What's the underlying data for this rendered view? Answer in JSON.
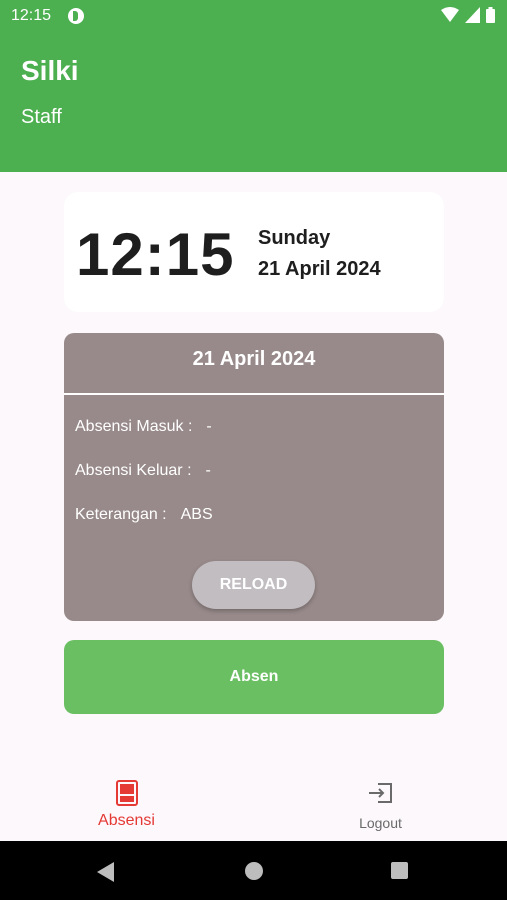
{
  "status_bar": {
    "time": "12:15"
  },
  "header": {
    "title": "Silki",
    "subtitle": "Staff"
  },
  "clock": {
    "time": "12:15",
    "day": "Sunday",
    "date": "21 April 2024"
  },
  "attendance": {
    "date": "21 April 2024",
    "rows": [
      {
        "label": "Absensi Masuk :",
        "value": "-"
      },
      {
        "label": "Absensi Keluar :",
        "value": "-"
      },
      {
        "label": "Keterangan :",
        "value": "ABS"
      }
    ],
    "reload_label": "RELOAD"
  },
  "absen_label": "Absen",
  "bottom_nav": {
    "items": [
      {
        "label": "Absensi",
        "icon": "document-icon",
        "active": true
      },
      {
        "label": "Logout",
        "icon": "logout-icon",
        "active": false
      }
    ]
  },
  "colors": {
    "header": "#4caf50",
    "attendance_card": "#988a8a",
    "absen_button": "#6bbf63",
    "active_nav": "#e53935"
  }
}
